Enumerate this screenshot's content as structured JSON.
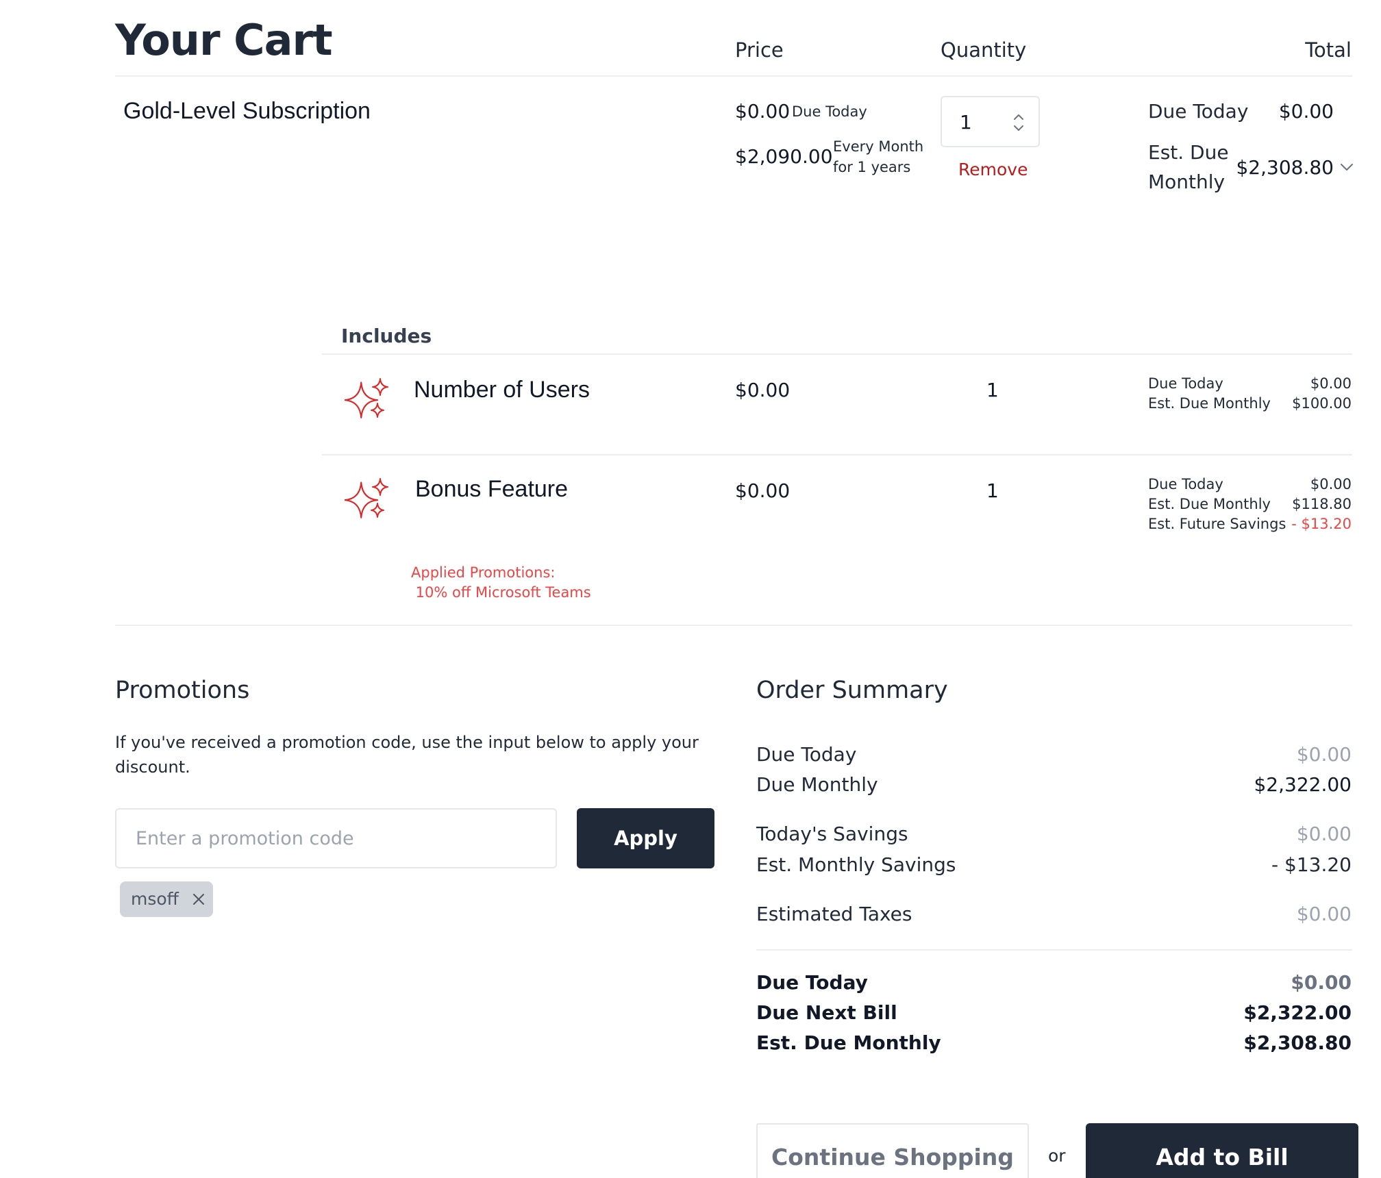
{
  "header": {
    "title": "Your Cart",
    "col_price": "Price",
    "col_quantity": "Quantity",
    "col_total": "Total"
  },
  "main_item": {
    "name": "Gold-Level Subscription",
    "price_today": "$0.00",
    "price_today_label": "Due Today",
    "price_recurring": "$2,090.00",
    "price_recurring_label_1": "Every Month",
    "price_recurring_label_2": "for 1 years",
    "quantity": "1",
    "remove_label": "Remove",
    "total_due_today_label": "Due Today",
    "total_due_today_value": "$0.00",
    "total_est_label_1": "Est. Due",
    "total_est_label_2": "Monthly",
    "total_est_value": "$2,308.80",
    "expand_icon": "chevron-down-icon"
  },
  "includes": {
    "heading": "Includes",
    "items": [
      {
        "name": "Number of Users",
        "icon": "sparkles-icon",
        "price": "$0.00",
        "quantity": "1",
        "due_today_label": "Due Today",
        "due_today_value": "$0.00",
        "est_monthly_label": "Est. Due Monthly",
        "est_monthly_value": "$100.00"
      },
      {
        "name": "Bonus Feature",
        "icon": "sparkles-icon",
        "price": "$0.00",
        "quantity": "1",
        "due_today_label": "Due Today",
        "due_today_value": "$0.00",
        "est_monthly_label": "Est. Due Monthly",
        "est_monthly_value": "$118.80",
        "est_savings_label": "Est. Future Savings",
        "est_savings_value": "- $13.20",
        "promotions_text": "Applied Promotions:\n 10% off Microsoft Teams"
      }
    ]
  },
  "promotions": {
    "heading": "Promotions",
    "description": "If you've received a promotion code, use the input below to apply your discount.",
    "input_value": "",
    "input_placeholder": "Enter a promotion code",
    "apply_label": "Apply",
    "applied_code": "msoff"
  },
  "summary": {
    "heading": "Order Summary",
    "due_today_label": "Due Today",
    "due_today_value": "$0.00",
    "due_monthly_label": "Due Monthly",
    "due_monthly_value": "$2,322.00",
    "todays_savings_label": "Today's Savings",
    "todays_savings_value": "$0.00",
    "est_monthly_savings_label": "Est. Monthly Savings",
    "est_monthly_savings_value": "- $13.20",
    "taxes_label": "Estimated Taxes",
    "taxes_value": "$0.00",
    "final_due_today_label": "Due Today",
    "final_due_today_value": "$0.00",
    "final_next_bill_label": "Due Next Bill",
    "final_next_bill_value": "$2,322.00",
    "final_est_monthly_label": "Est. Due Monthly",
    "final_est_monthly_value": "$2,308.80"
  },
  "actions": {
    "continue_label": "Continue Shopping",
    "or_label": "or",
    "add_to_bill_label": "Add to Bill"
  },
  "colors": {
    "primary_dark": "#1f2937",
    "accent_red": "#ef4444",
    "remove_red": "#b91c1c",
    "muted_gray": "#9ca3af"
  }
}
